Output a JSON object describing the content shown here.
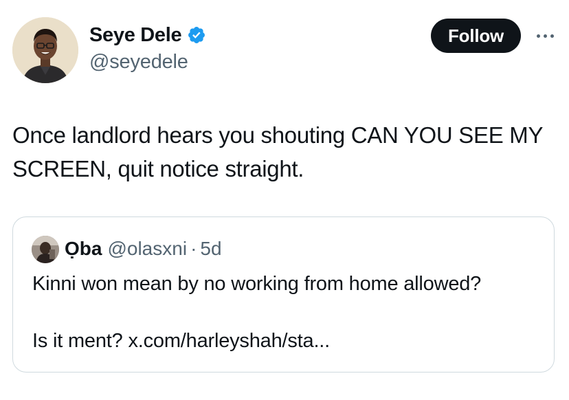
{
  "tweet": {
    "author": {
      "name": "Seye Dele",
      "handle": "@seyedele",
      "verified": true,
      "avatar_icon": "profile-photo"
    },
    "follow_label": "Follow",
    "more_icon": "ellipsis-icon",
    "text": "Once landlord hears you shouting CAN YOU SEE MY SCREEN, quit notice straight."
  },
  "quote": {
    "author": {
      "name": "Ọba",
      "handle": "@olasxni",
      "separator": "·",
      "time": "5d"
    },
    "text_line1": "Kinni won mean by no working from home allowed?",
    "text_line2_prefix": "Is it ment? ",
    "text_line2_link": "x.com/harleyshah/sta..."
  },
  "colors": {
    "text_primary": "#0f1419",
    "text_secondary": "#536471",
    "verified_blue": "#1d9bf0",
    "button_bg": "#0f1419",
    "border": "#cfd9de"
  }
}
